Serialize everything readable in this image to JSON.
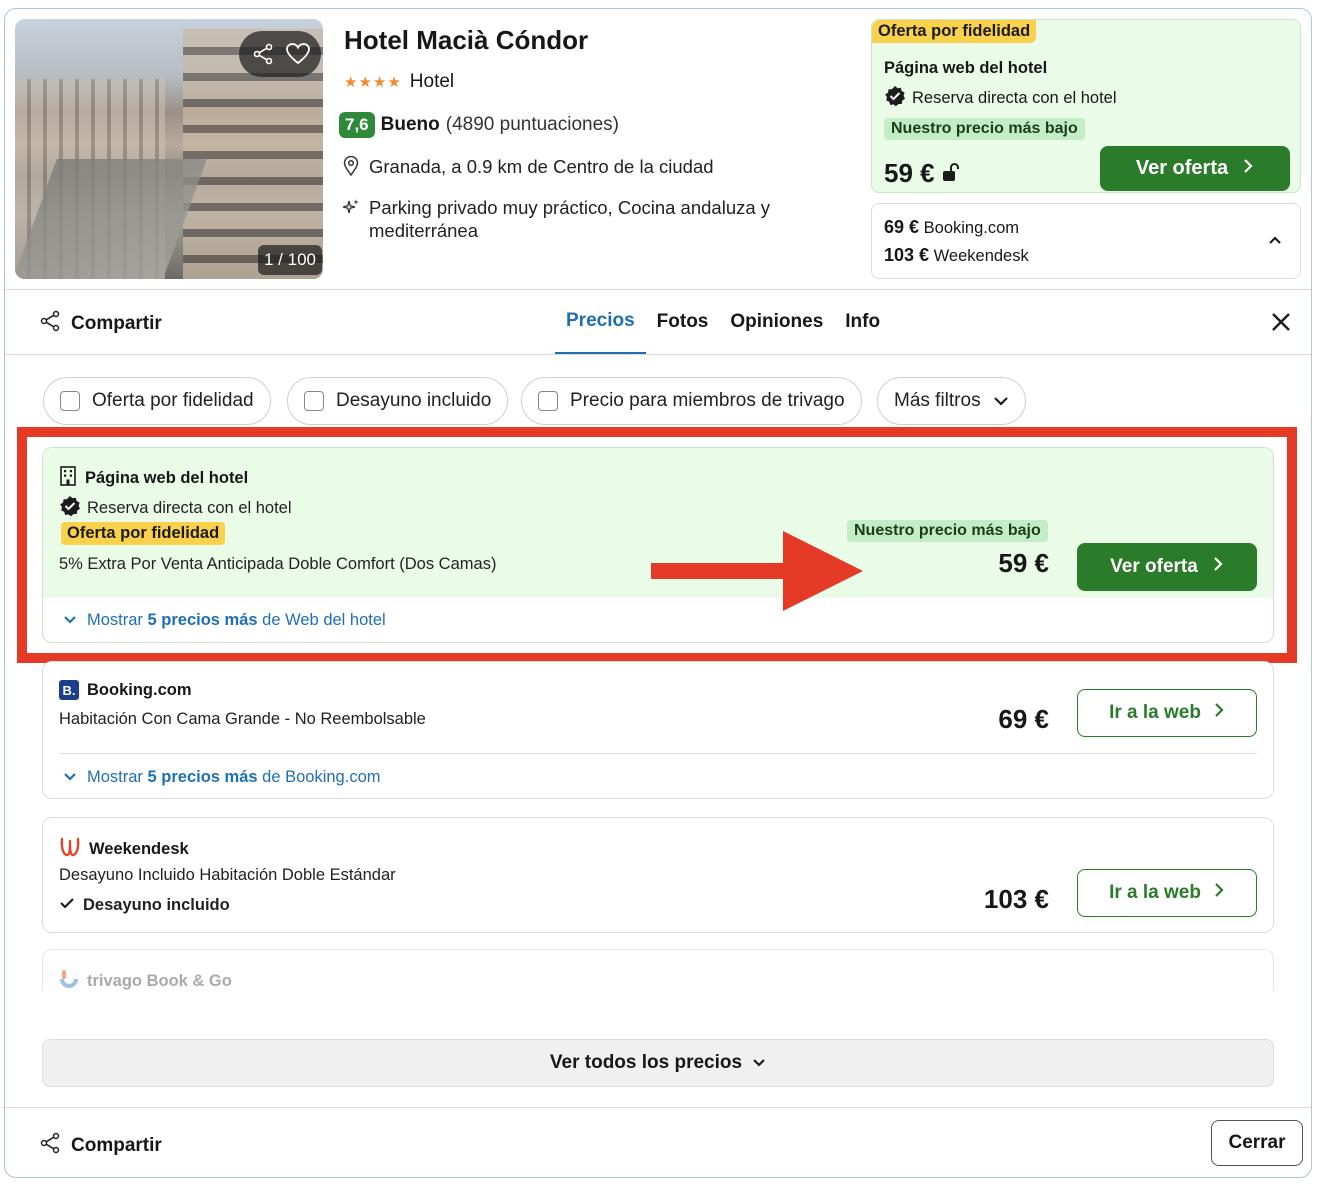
{
  "hotel": {
    "name": "Hotel Macià Cóndor",
    "stars": "★★★★",
    "type": "Hotel",
    "rating": "7,6",
    "rating_label": "Bueno",
    "rating_count": "(4890 puntuaciones)",
    "location": "Granada, a 0.9 km de Centro de la ciudad",
    "highlights_line1": "Parking privado muy práctico, Cocina andaluza y",
    "highlights_line2": "mediterránea",
    "photo_counter": "1 / 100"
  },
  "top_offer": {
    "loyalty_tag": "Oferta por fidelidad",
    "source": "Página web del hotel",
    "direct": "Reserva directa con el hotel",
    "lowest_tag": "Nuestro precio más bajo",
    "price": "59 €",
    "button": "Ver oferta"
  },
  "alt_prices": [
    {
      "price": "69 €",
      "provider": "Booking.com"
    },
    {
      "price": "103 €",
      "provider": "Weekendesk"
    }
  ],
  "nav": {
    "share": "Compartir",
    "tabs": [
      "Precios",
      "Fotos",
      "Opiniones",
      "Info"
    ],
    "active_tab": "Precios"
  },
  "filters": [
    "Oferta por fidelidad",
    "Desayuno incluido",
    "Precio para miembros de trivago",
    "Más filtros"
  ],
  "offers": [
    {
      "provider": "Página web del hotel",
      "direct": "Reserva directa con el hotel",
      "loyalty_tag": "Oferta por fidelidad",
      "room": "5% Extra Por Venta Anticipada Doble Comfort (Dos Camas)",
      "lowest_tag": "Nuestro precio más bajo",
      "price": "59 €",
      "button": "Ver oferta",
      "more_prefix": "Mostrar",
      "more_count": "5 precios más",
      "more_suffix": "de Web del hotel"
    },
    {
      "provider": "Booking.com",
      "room": "Habitación Con Cama Grande - No Reembolsable",
      "price": "69 €",
      "button": "Ir a la web",
      "more_prefix": "Mostrar",
      "more_count": "5 precios más",
      "more_suffix": "de Booking.com"
    },
    {
      "provider": "Weekendesk",
      "room": "Desayuno Incluido Habitación Doble Estándar",
      "amenity": "Desayuno incluido",
      "price": "103 €",
      "button": "Ir a la web"
    },
    {
      "provider": "trivago Book & Go"
    }
  ],
  "all_prices_button": "Ver todos los precios",
  "footer": {
    "share": "Compartir",
    "close": "Cerrar"
  },
  "colors": {
    "accent_blue": "#1f6fb5",
    "green_button": "#2a7c2a",
    "loyalty_yellow": "#f9d14c",
    "highlight_red": "#e53a25"
  }
}
